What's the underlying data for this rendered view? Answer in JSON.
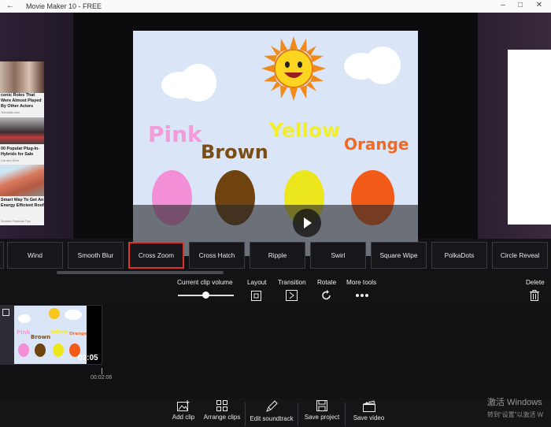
{
  "window": {
    "title": "Movie Maker 10 - FREE",
    "back_icon": "back-arrow-icon",
    "controls": [
      "minimize-icon",
      "maximize-icon",
      "close-icon"
    ]
  },
  "side_ad": {
    "items": [
      {
        "title": "conic Roles That Were Almost Played By Other Actors",
        "source": "Trendtalk.com"
      },
      {
        "title": "00 Popular Plug-In-Hybrids for Sale",
        "source": "Car and Drive"
      },
      {
        "title": "Smart Way To Get An Energy Efficient Roof",
        "source": "Smarter Financial Tips"
      }
    ]
  },
  "preview": {
    "words": [
      "Pink",
      "Brown",
      "Yellow",
      "Orange"
    ],
    "word_colors": [
      "#f39ad8",
      "#7a4e17",
      "#f2ee28",
      "#f06a20"
    ],
    "egg_colors": [
      "#f38fd6",
      "#6e430f",
      "#ece71d",
      "#f25b17"
    ]
  },
  "transitions": {
    "items": [
      "Wind",
      "Smooth Blur",
      "Cross Zoom",
      "Cross Hatch",
      "Ripple",
      "Swirl",
      "Square Wipe",
      "PolkaDots",
      "Circle Reveal"
    ],
    "selected": "Cross Zoom",
    "selected_color": "#e1322c"
  },
  "tools": {
    "volume_label": "Current clip volume",
    "volume_level": 0.5,
    "layout_label": "Layout",
    "transition_label": "Transition",
    "rotate_label": "Rotate",
    "more_label": "More tools",
    "delete_label": "Delete"
  },
  "timeline": {
    "clip_duration": "02:05",
    "playhead_time": "00:02:06"
  },
  "bottom_toolbar": {
    "add_clip": "Add clip",
    "arrange_clips": "Arrange clips",
    "edit_soundtrack": "Edit soundtrack",
    "save_project": "Save project",
    "save_video": "Save video"
  },
  "os_watermark": {
    "line1": "激活 Windows",
    "line2": "转到“设置”以激活 W"
  }
}
